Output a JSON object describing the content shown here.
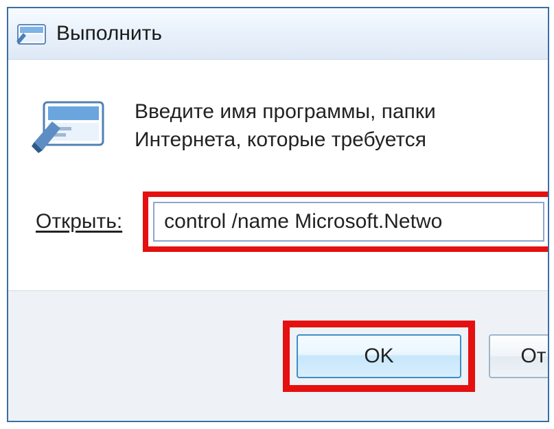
{
  "dialog": {
    "title": "Выполнить",
    "info_line1": "Введите имя программы, папки",
    "info_line2": "Интернета, которые требуется",
    "open_label": "Открыть:",
    "input_value": "control /name Microsoft.Netwo",
    "buttons": {
      "ok": "OK",
      "cancel": "От"
    }
  },
  "colors": {
    "highlight": "#e51010",
    "border": "#3a6ea5"
  }
}
